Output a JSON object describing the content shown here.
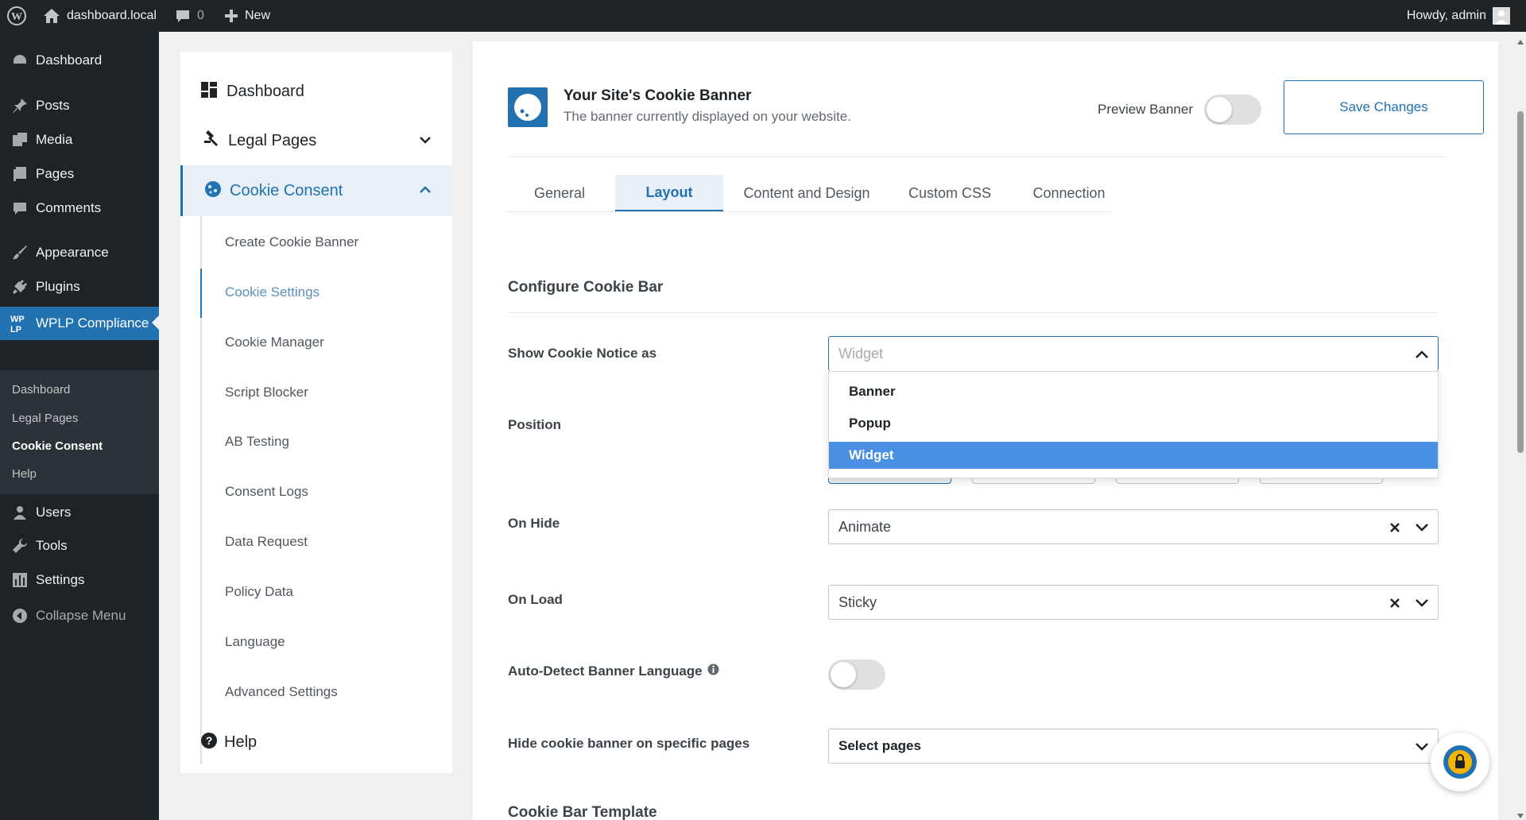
{
  "admin_bar": {
    "site_name": "dashboard.local",
    "comments_count": "0",
    "new_label": "New",
    "greeting": "Howdy, admin"
  },
  "admin_menu": {
    "items": [
      {
        "label": "Dashboard",
        "icon": "dashboard-icon"
      },
      {
        "label": "Posts",
        "icon": "pin-icon"
      },
      {
        "label": "Media",
        "icon": "media-icon"
      },
      {
        "label": "Pages",
        "icon": "page-icon"
      },
      {
        "label": "Comments",
        "icon": "comment-icon"
      },
      {
        "label": "Appearance",
        "icon": "brush-icon"
      },
      {
        "label": "Plugins",
        "icon": "plug-icon"
      },
      {
        "label": "WPLP Compliance",
        "icon": "wplp-logo-icon"
      },
      {
        "label": "Users",
        "icon": "users-icon"
      },
      {
        "label": "Tools",
        "icon": "wrench-icon"
      },
      {
        "label": "Settings",
        "icon": "settings-icon"
      },
      {
        "label": "Collapse Menu",
        "icon": "collapse-icon"
      }
    ],
    "submenu": [
      "Dashboard",
      "Legal Pages",
      "Cookie Consent",
      "Help"
    ]
  },
  "plugin_sidebar": {
    "dashboard": "Dashboard",
    "legal_pages": "Legal Pages",
    "cookie_consent": "Cookie Consent",
    "sub_items": [
      "Create Cookie Banner",
      "Cookie Settings",
      "Cookie Manager",
      "Script Blocker",
      "AB Testing",
      "Consent Logs",
      "Data Request",
      "Policy Data",
      "Language",
      "Advanced Settings"
    ],
    "help": "Help"
  },
  "header": {
    "title": "Your Site's Cookie Banner",
    "subtitle": "The banner currently displayed on your website.",
    "preview_label": "Preview Banner",
    "save_label": "Save Changes"
  },
  "tabs": [
    "General",
    "Layout",
    "Content and Design",
    "Custom CSS",
    "Connection"
  ],
  "section_title": "Configure Cookie Bar",
  "fields": {
    "show_notice_label": "Show Cookie Notice as",
    "show_notice_value": "Widget",
    "show_notice_options": [
      "Banner",
      "Popup",
      "Widget"
    ],
    "position_label": "Position",
    "on_hide_label": "On Hide",
    "on_hide_value": "Animate",
    "on_load_label": "On Load",
    "on_load_value": "Sticky",
    "auto_detect_label": "Auto-Detect Banner Language",
    "hide_pages_label": "Hide cookie banner on specific pages",
    "hide_pages_placeholder": "Select pages"
  },
  "template_title": "Cookie Bar Template",
  "colors": {
    "accent": "#2271b1",
    "admin_dark": "#1d2327",
    "selected_option": "#4a90e2"
  }
}
